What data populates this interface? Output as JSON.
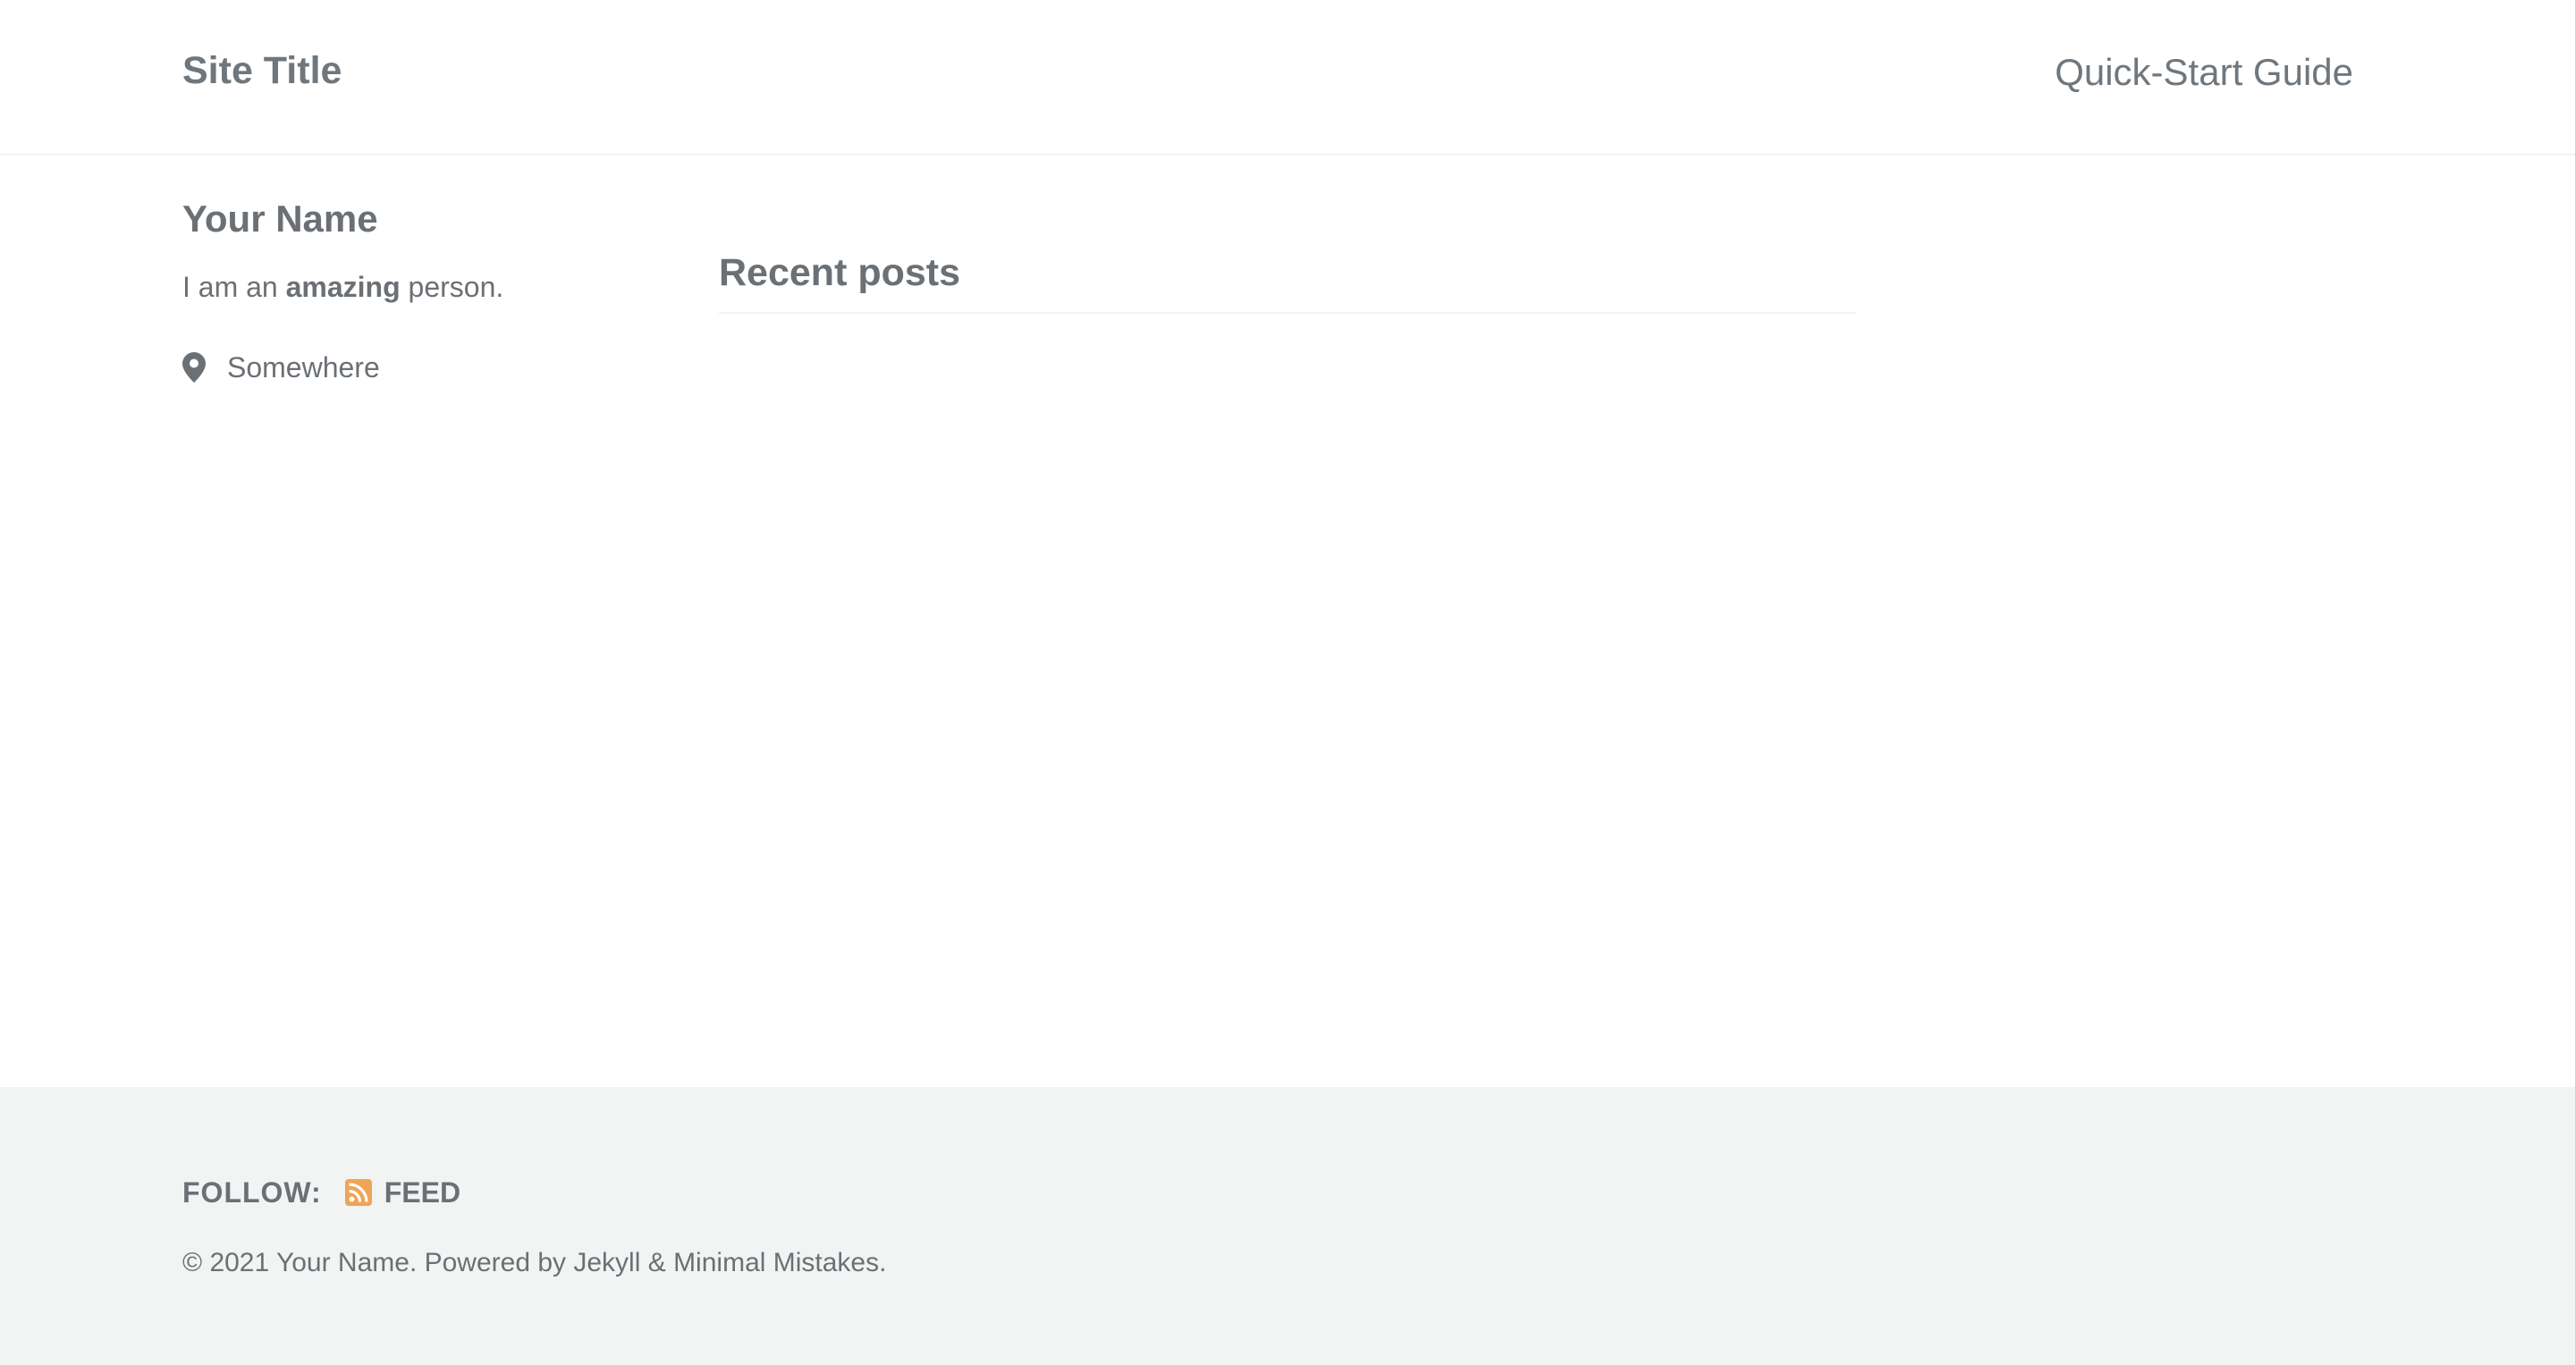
{
  "header": {
    "site_title": "Site Title",
    "nav_link": "Quick-Start Guide"
  },
  "sidebar": {
    "author_name": "Your Name",
    "bio_prefix": "I am an ",
    "bio_emphasis": "amazing",
    "bio_suffix": " person.",
    "location": "Somewhere",
    "location_icon": "map-marker-icon"
  },
  "main": {
    "section_title": "Recent posts"
  },
  "footer": {
    "follow_label": "FOLLOW:",
    "feed_label": "FEED",
    "feed_icon": "rss-icon",
    "feed_icon_color": "#f26522",
    "copyright": "© 2021 Your Name. Powered by Jekyll & Minimal Mistakes."
  }
}
